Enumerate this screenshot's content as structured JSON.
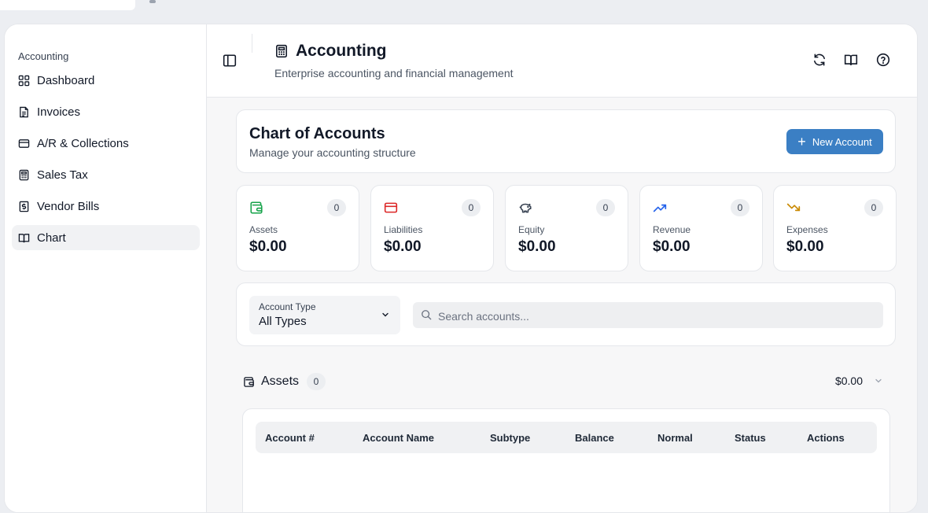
{
  "sidebar": {
    "heading": "Accounting",
    "items": [
      {
        "label": "Dashboard",
        "icon": "grid-icon"
      },
      {
        "label": "Invoices",
        "icon": "document-icon"
      },
      {
        "label": "A/R & Collections",
        "icon": "credit-card-icon"
      },
      {
        "label": "Sales Tax",
        "icon": "calculator-icon"
      },
      {
        "label": "Vendor Bills",
        "icon": "receipt-icon"
      },
      {
        "label": "Chart",
        "icon": "book-open-icon",
        "active": true
      }
    ]
  },
  "header": {
    "title": "Accounting",
    "subtitle": "Enterprise accounting and financial management"
  },
  "chart_of_accounts": {
    "title": "Chart of Accounts",
    "subtitle": "Manage your accounting structure",
    "new_button": "New Account"
  },
  "stats": [
    {
      "label": "Assets",
      "count": "0",
      "value": "$0.00",
      "color": "#16a34a",
      "icon": "wallet-icon"
    },
    {
      "label": "Liabilities",
      "count": "0",
      "value": "$0.00",
      "color": "#dc2626",
      "icon": "credit-card-icon"
    },
    {
      "label": "Equity",
      "count": "0",
      "value": "$0.00",
      "color": "#374151",
      "icon": "piggy-bank-icon"
    },
    {
      "label": "Revenue",
      "count": "0",
      "value": "$0.00",
      "color": "#2563eb",
      "icon": "trending-up-icon"
    },
    {
      "label": "Expenses",
      "count": "0",
      "value": "$0.00",
      "color": "#ca8a04",
      "icon": "trending-down-icon"
    }
  ],
  "filters": {
    "account_type_label": "Account Type",
    "account_type_value": "All Types",
    "search_placeholder": "Search accounts..."
  },
  "section": {
    "title": "Assets",
    "count": "0",
    "total": "$0.00"
  },
  "table": {
    "columns": [
      "Account #",
      "Account Name",
      "Subtype",
      "Balance",
      "Normal",
      "Status",
      "Actions"
    ]
  },
  "colors": {
    "accent": "#3b7fc4"
  }
}
